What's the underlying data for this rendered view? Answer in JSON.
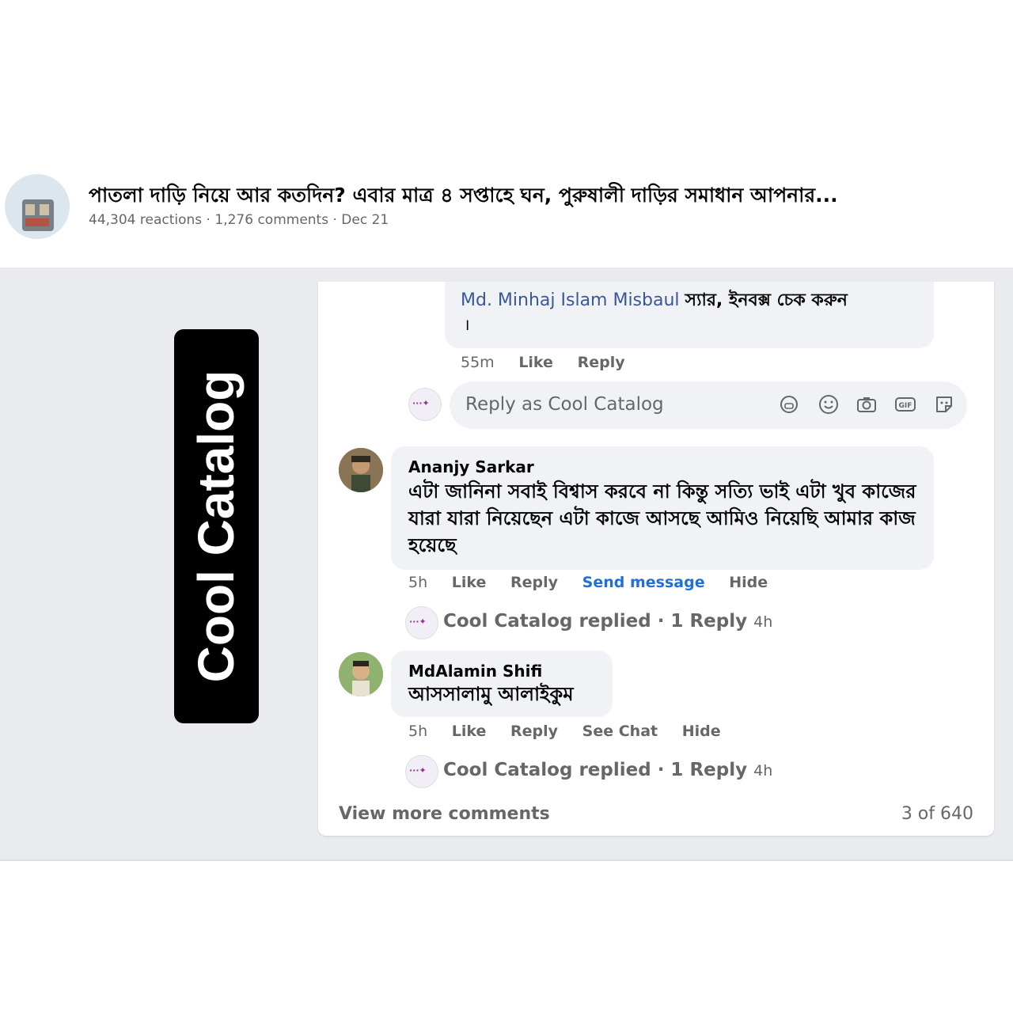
{
  "post": {
    "title": "পাতলা দাড়ি নিয়ে আর কতদিন? এবার মাত্র ৪ সপ্তাহে ঘন, পুরুষালী দাড়ির সমাধান আপনার...",
    "reactions": "44,304 reactions",
    "comments": "1,276 comments",
    "date": "Dec 21",
    "separator": " · "
  },
  "brand": {
    "name": "Cool Catalog"
  },
  "top_comment": {
    "mention": "Md. Minhaj Islam Misbaul",
    "text": "স্যার, ইনবক্স চেক করুন",
    "caret": "।",
    "time": "55m",
    "like": "Like",
    "reply": "Reply"
  },
  "reply_box": {
    "placeholder": "Reply as Cool Catalog",
    "icons": [
      "avatar-sticker-icon",
      "emoji-icon",
      "camera-icon",
      "gif-icon",
      "sticker-icon"
    ],
    "gif_label": "GIF"
  },
  "comments": [
    {
      "author": "Ananjy Sarkar",
      "text": "এটা জানিনা সবাই বিশ্বাস করবে না কিন্তু সত্যি ভাই এটা খুব কাজের যারা যারা নিয়েছেন এটা কাজে আসছে আমিও নিয়েছি আমার কাজ হয়েছে",
      "time": "5h",
      "like": "Like",
      "reply": "Reply",
      "extra": "Send message",
      "hide": "Hide",
      "replied": "Cool Catalog replied · 1 Reply",
      "replied_time": "4h"
    },
    {
      "author": "MdAlamin Shifi",
      "text": "আসসালামু আলাইকুম",
      "time": "5h",
      "like": "Like",
      "reply": "Reply",
      "extra": "See Chat",
      "hide": "Hide",
      "replied": "Cool Catalog replied · 1 Reply",
      "replied_time": "4h"
    }
  ],
  "footer": {
    "view_more": "View more comments",
    "count": "3 of 640"
  },
  "colors": {
    "link": "#385898",
    "accent_blue": "#216fdb",
    "bubble": "#f0f2f5",
    "band": "#e9ebee",
    "muted": "#65676b"
  }
}
